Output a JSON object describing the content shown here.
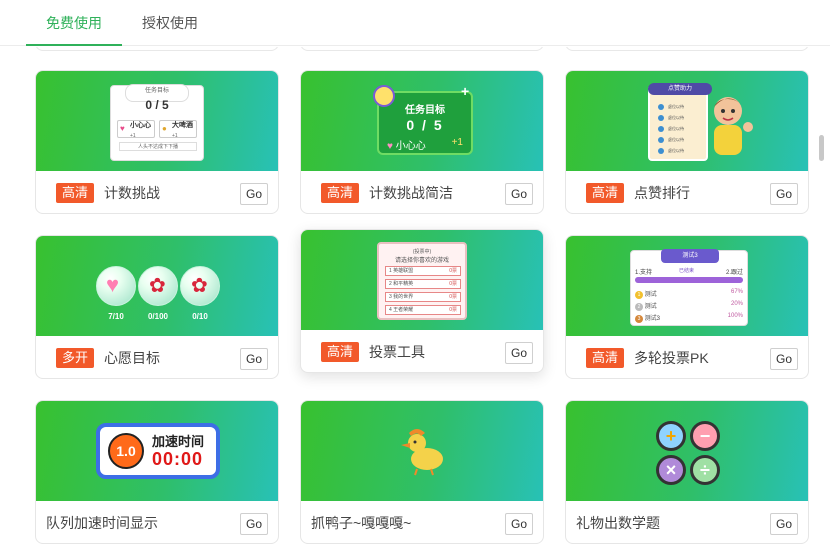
{
  "tabs": [
    {
      "label": "免费使用",
      "active": true
    },
    {
      "label": "授权使用",
      "active": false
    }
  ],
  "cards": [
    {
      "badge": "高清",
      "title": "计数挑战",
      "go": "Go",
      "thumb": {
        "panel_title": "任务目标",
        "count": "0 / 5",
        "item1": "小心心",
        "item1_sub": "+1",
        "item2": "大啤酒",
        "item2_sub": "+1",
        "bar": "人头不达成下下播"
      }
    },
    {
      "badge": "高清",
      "title": "计数挑战简洁",
      "go": "Go",
      "thumb": {
        "panel_title": "任务目标",
        "count": "0 / 5",
        "item": "小心心",
        "plus": "+1"
      }
    },
    {
      "badge": "高清",
      "title": "点赞排行",
      "go": "Go",
      "thumb": {
        "panel_title": "点赞助力",
        "rows": [
          "虚位以待",
          "虚位以待",
          "虚位以待",
          "虚位以待",
          "虚位以待"
        ]
      }
    },
    {
      "badge": "多开",
      "title": "心愿目标",
      "go": "Go",
      "thumb": {
        "labels": [
          "7/10",
          "0/100",
          "0/10"
        ]
      }
    },
    {
      "badge": "高清",
      "title": "投票工具",
      "go": "Go",
      "thumb": {
        "status": "(投票中)",
        "question": "请选择你喜欢的游戏",
        "options": [
          {
            "label": "1 英雄联盟",
            "votes": "0票"
          },
          {
            "label": "2 和平精英",
            "votes": "0票"
          },
          {
            "label": "3 我的世界",
            "votes": "0票"
          },
          {
            "label": "4 王者荣耀",
            "votes": "0票"
          }
        ]
      }
    },
    {
      "badge": "高清",
      "title": "多轮投票PK",
      "go": "Go",
      "thumb": {
        "panel_title": "测试3",
        "left": "1.支持",
        "middle": "已结束",
        "right": "2.跟过",
        "rows": [
          {
            "rank": "1",
            "name": "测试",
            "pct": "67%"
          },
          {
            "rank": "2",
            "name": "测试",
            "pct": "20%"
          },
          {
            "rank": "3",
            "name": "测试3",
            "pct": "100%"
          }
        ]
      }
    },
    {
      "badge": "",
      "title": "队列加速时间显示",
      "go": "Go",
      "thumb": {
        "multiplier": "1.0",
        "label": "加速时间",
        "time": "00:00"
      }
    },
    {
      "badge": "",
      "title": "抓鸭子~嘎嘎嘎~",
      "go": "Go",
      "thumb": {}
    },
    {
      "badge": "",
      "title": "礼物出数学题",
      "go": "Go",
      "thumb": {
        "symbols": [
          "+",
          "−",
          "×",
          "÷"
        ]
      }
    }
  ],
  "colors": {
    "accent": "#2fb15a",
    "badge": "#f2592a"
  }
}
